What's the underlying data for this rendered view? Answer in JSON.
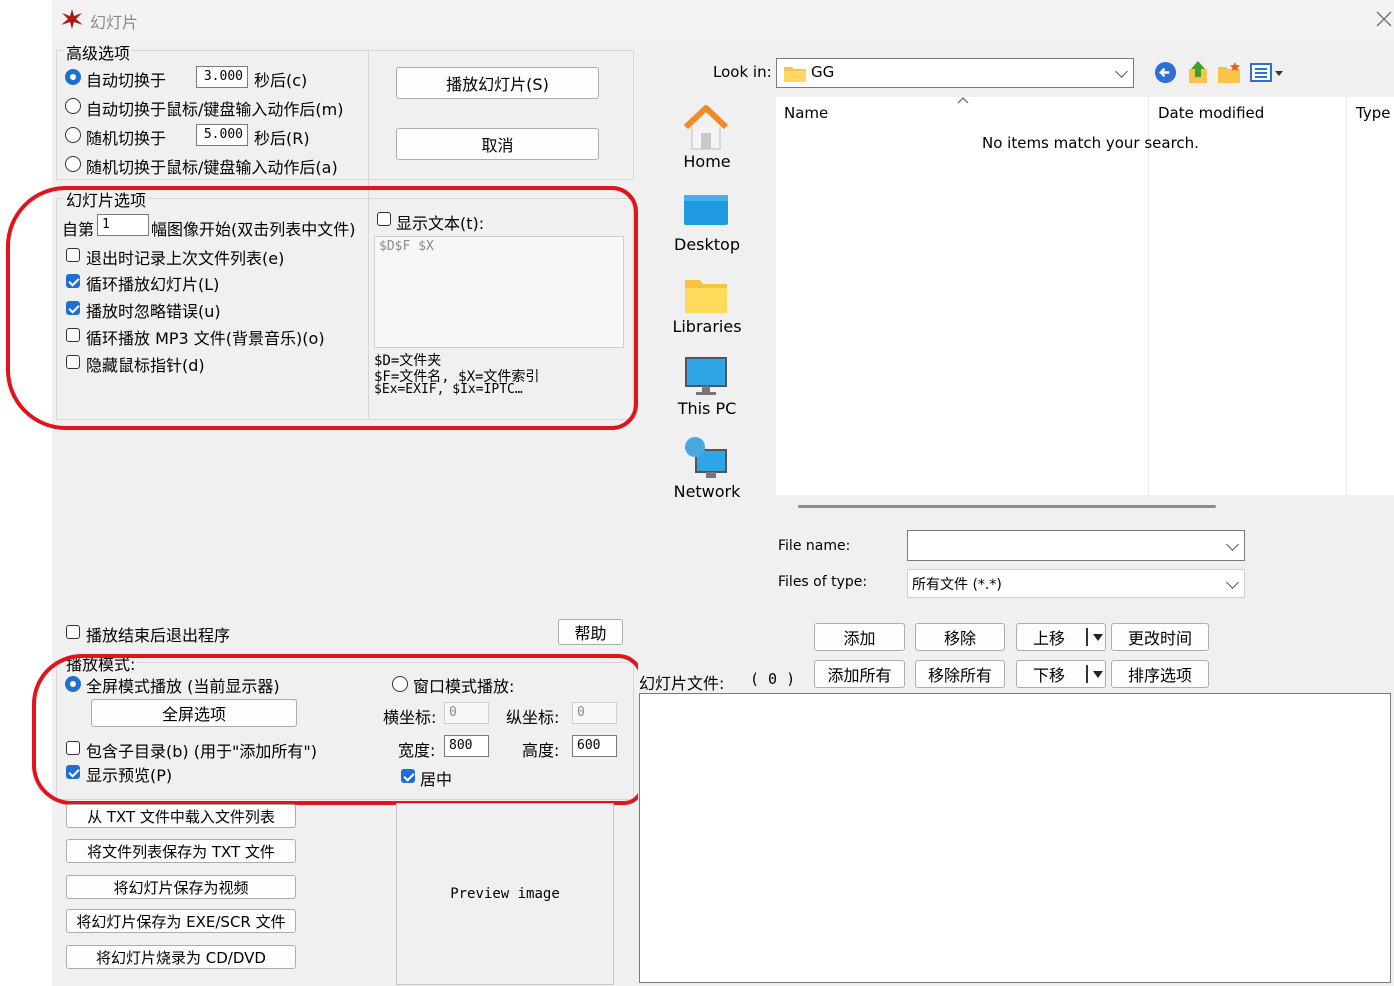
{
  "window": {
    "title": "幻灯片"
  },
  "advanced": {
    "group_label": "高级选项",
    "opt1_label": "自动切换于",
    "opt1_value": "3.000",
    "opt1_suffix": "秒后(c)",
    "opt2_label": "自动切换于鼠标/键盘输入动作后(m)",
    "opt3_label": "随机切换于",
    "opt3_value": "5.000",
    "opt3_suffix": "秒后(R)",
    "opt4_label": "随机切换于鼠标/键盘输入动作后(a)"
  },
  "actions": {
    "play_label": "播放幻灯片(S)",
    "cancel_label": "取消"
  },
  "slide_options": {
    "group_label": "幻灯片选项",
    "start_prefix": "自第",
    "start_value": "1",
    "start_suffix": "幅图像开始(双击列表中文件)",
    "remember_label": "退出时记录上次文件列表(e)",
    "loop_label": "循环播放幻灯片(L)",
    "ignore_errors_label": "播放时忽略错误(u)",
    "mp3_label": "循环播放 MP3 文件(背景音乐)(o)",
    "hide_cursor_label": "隐藏鼠标指针(d)",
    "show_text_label": "显示文本(t):",
    "text_template": "$D$F $X",
    "help_line1": "$D=文件夹",
    "help_line2": "$F=文件名, $X=文件索引",
    "help_line3": "$Ex=EXIF, $Ix=IPTC…"
  },
  "exit_after_label": "播放结束后退出程序",
  "help_button": "帮助",
  "play_mode": {
    "group_label": "播放模式:",
    "fullscreen_label": "全屏模式播放 (当前显示器)",
    "fullscreen_options_button": "全屏选项",
    "window_label": "窗口模式播放:",
    "x_label": "横坐标:",
    "x_value": "0",
    "y_label": "纵坐标:",
    "y_value": "0",
    "width_label": "宽度:",
    "width_value": "800",
    "height_label": "高度:",
    "height_value": "600",
    "center_label": "居中",
    "subdirs_label": "包含子目录(b) (用于\"添加所有\")",
    "preview_label": "显示预览(P)"
  },
  "list_buttons": [
    "从 TXT 文件中载入文件列表",
    "将文件列表保存为 TXT 文件",
    "将幻灯片保存为视频",
    "将幻灯片保存为 EXE/SCR 文件",
    "将幻灯片烧录为 CD/DVD"
  ],
  "preview_text": "Preview image",
  "file_dialog": {
    "look_in_label": "Look in:",
    "look_in_value": "GG",
    "places": [
      "Home",
      "Desktop",
      "Libraries",
      "This PC",
      "Network"
    ],
    "columns": [
      "Name",
      "Date modified",
      "Type"
    ],
    "empty_message": "No items match your search.",
    "file_name_label": "File name:",
    "file_name_value": "",
    "file_type_label": "Files of type:",
    "file_type_value": "所有文件 (*.*)"
  },
  "file_list": {
    "add": "添加",
    "remove": "移除",
    "up": "上移",
    "change_time": "更改时间",
    "add_all": "添加所有",
    "remove_all": "移除所有",
    "down": "下移",
    "sort_options": "排序选项",
    "slides_label": "幻灯片文件:",
    "slides_count": "( 0 )"
  },
  "colors": {
    "highlight_red": "#e0141a",
    "accent_blue": "#1f6fd1",
    "panel_bg": "#f0f0f0"
  }
}
